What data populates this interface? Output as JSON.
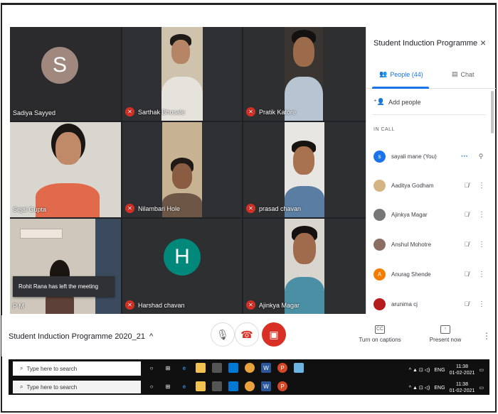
{
  "grid": {
    "tiles": [
      {
        "name": "Sadiya Sayyed",
        "avatar_letter": "S",
        "avatar_color": "#a1887f",
        "muted": false
      },
      {
        "name": "Sarthak Bhosale",
        "muted": true
      },
      {
        "name": "Pratik Katore",
        "muted": true
      },
      {
        "name": "Sejal Gupta",
        "muted": false
      },
      {
        "name": "Nilambari Hole",
        "muted": true
      },
      {
        "name": "prasad chavan",
        "muted": true
      },
      {
        "name": "P M",
        "muted": false
      },
      {
        "name": "Harshad chavan",
        "avatar_letter": "H",
        "avatar_color": "#00897b",
        "muted": true
      },
      {
        "name": "Ajinkya Magar",
        "muted": true
      }
    ],
    "toast": "Rohit Rana has left the meeting"
  },
  "panel": {
    "title": "Student Induction Programme 20...",
    "close_icon": "×",
    "tab_people": "People (44)",
    "tab_chat": "Chat",
    "add_people": "Add people",
    "in_call_label": "IN CALL",
    "participants": [
      {
        "name": "sayali mane (You)",
        "avatar": "s",
        "color": "#1a73e8"
      },
      {
        "name": "Aaditya Godham",
        "avatar": "",
        "color": "#d4b483"
      },
      {
        "name": "Ajinkya Magar",
        "avatar": "",
        "color": "#777777"
      },
      {
        "name": "Anshul Mohotre",
        "avatar": "",
        "color": "#8d6e63"
      },
      {
        "name": "Anurag Shende",
        "avatar": "A",
        "color": "#f57c00"
      },
      {
        "name": "arunima cj",
        "avatar": "",
        "color": "#b71c1c"
      }
    ]
  },
  "bar": {
    "meeting_title": "Student Induction Programme 2020_21",
    "captions_label": "Turn on captions",
    "present_label": "Present now"
  },
  "taskbar": {
    "search_placeholder": "Type here to search",
    "lang": "ENG",
    "time": "11:38",
    "date": "01-02-2021",
    "time2": "11:38",
    "date2": "01-02-2021"
  }
}
